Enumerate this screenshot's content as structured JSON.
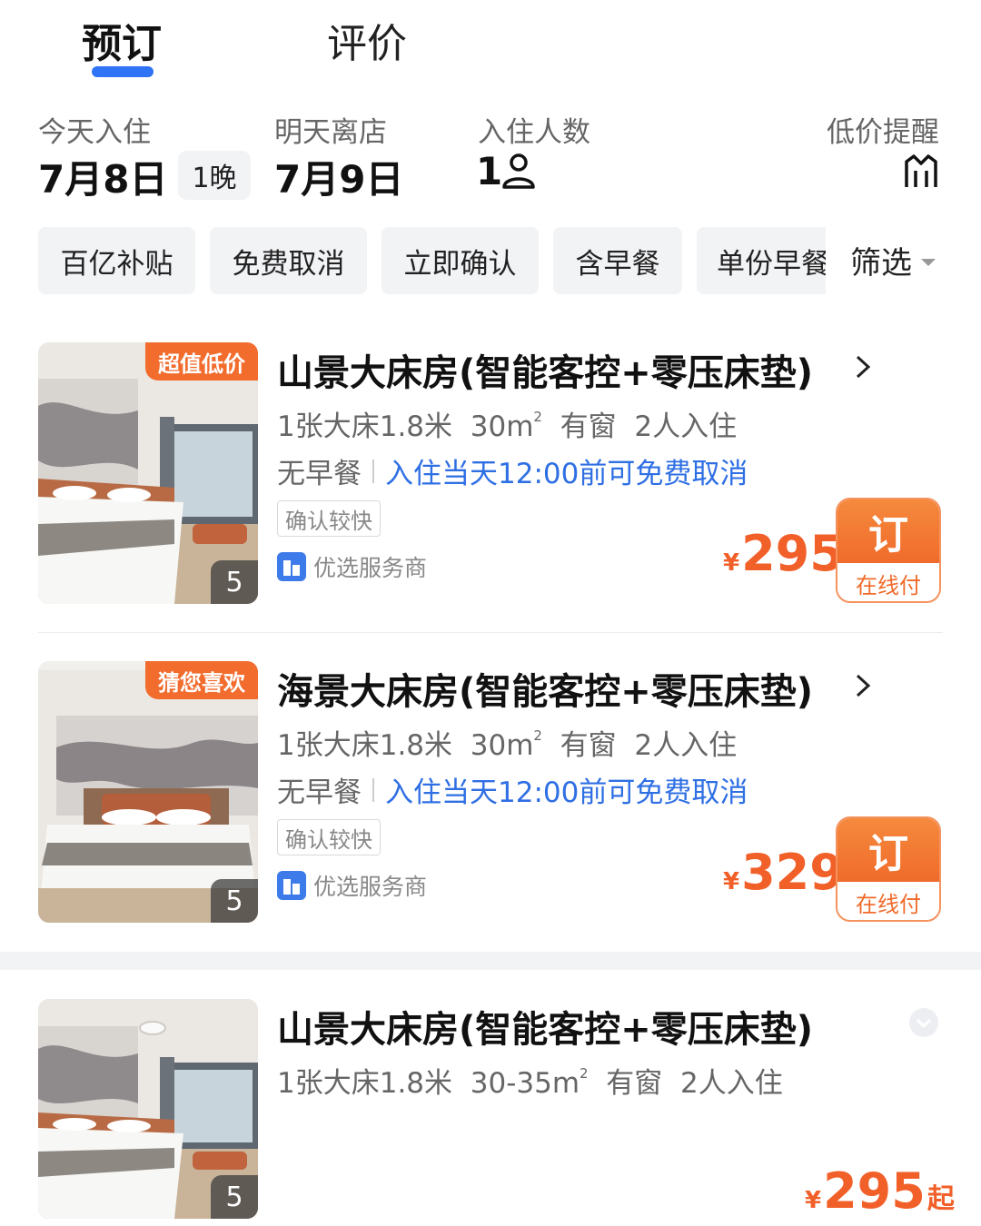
{
  "tabs": {
    "active": "预订",
    "inactive": "评价"
  },
  "stay": {
    "checkin_label": "今天入住",
    "checkin_date": "7月8日",
    "nights": "1晚",
    "checkout_label": "明天离店",
    "checkout_date": "7月9日",
    "guests_label": "入住人数",
    "guests_count": "1",
    "price_alert_label": "低价提醒",
    "guest_icon": "person-icon",
    "alert_icon": "price-alert-icon"
  },
  "filters": {
    "chips": [
      "百亿补贴",
      "免费取消",
      "立即确认",
      "含早餐",
      "单份早餐"
    ],
    "filter_label": "筛选"
  },
  "rooms": [
    {
      "badge": "超值低价",
      "photo_count": "5",
      "title": "山景大床房(智能客控+零压床垫)",
      "spec_bed": "1张大床1.8米",
      "spec_area": "30m",
      "spec_area_sup": "2",
      "spec_window": "有窗",
      "spec_guests": "2人入住",
      "meal": "无早餐",
      "cancel_policy": "入住当天12:00前可免费取消",
      "tag": "确认较快",
      "provider": "优选服务商",
      "currency": "¥",
      "price": "295",
      "book_label": "订",
      "pay_label": "在线付"
    },
    {
      "badge": "猜您喜欢",
      "photo_count": "5",
      "title": "海景大床房(智能客控+零压床垫)",
      "spec_bed": "1张大床1.8米",
      "spec_area": "30m",
      "spec_area_sup": "2",
      "spec_window": "有窗",
      "spec_guests": "2人入住",
      "meal": "无早餐",
      "cancel_policy": "入住当天12:00前可免费取消",
      "tag": "确认较快",
      "provider": "优选服务商",
      "currency": "¥",
      "price": "329",
      "book_label": "订",
      "pay_label": "在线付"
    },
    {
      "photo_count": "5",
      "title": "山景大床房(智能客控+零压床垫)",
      "spec_bed": "1张大床1.8米",
      "spec_area": "30-35m",
      "spec_area_sup": "2",
      "spec_window": "有窗",
      "spec_guests": "2人入住",
      "currency": "¥",
      "price": "295",
      "price_suffix": "起"
    }
  ],
  "colors": {
    "accent_blue": "#2f73f6",
    "price_orange": "#f2602a",
    "badge_orange": "#f26c2e",
    "cancel_blue": "#2f6fe4"
  }
}
